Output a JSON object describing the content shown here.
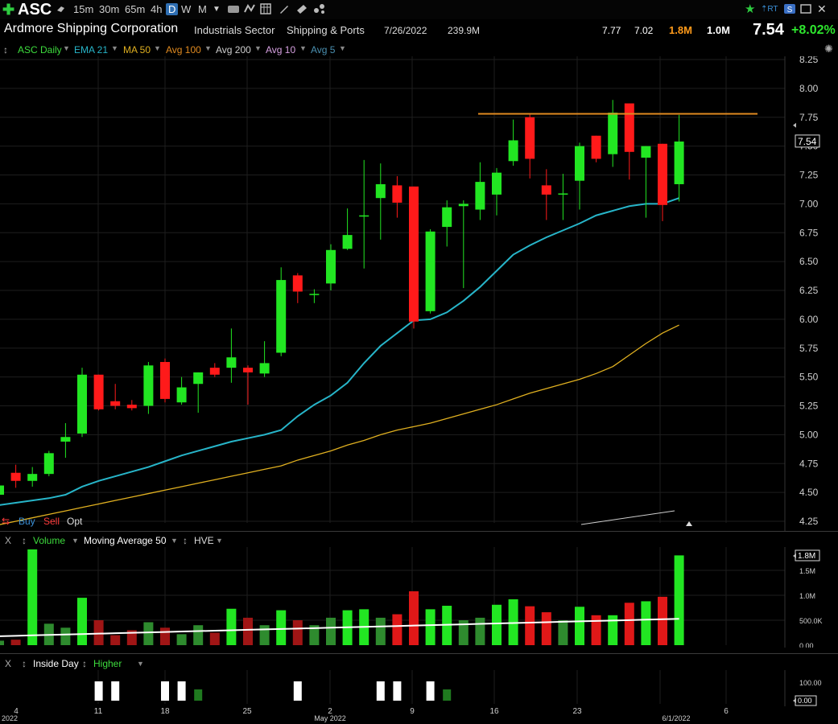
{
  "toolbar": {
    "symbol": "ASC",
    "timeframes": [
      "15m",
      "30m",
      "65m",
      "4h",
      "D",
      "W",
      "M"
    ],
    "selected_timeframe": "D",
    "right_labels": [
      "RT"
    ]
  },
  "info": {
    "company": "Ardmore Shipping Corporation",
    "sector": "Industrials Sector",
    "industry": "Shipping & Ports",
    "earnings_date": "7/26/2022",
    "market_cap": "239.9M",
    "high": "7.77",
    "low": "7.02",
    "volume": "1.8M",
    "avg_volume": "1.0M",
    "last": "7.54",
    "change_pct": "+8.02%"
  },
  "legend": {
    "items": [
      {
        "label": "ASC Daily",
        "color": "#3ddc3d"
      },
      {
        "label": "EMA 21",
        "color": "#27b5c9"
      },
      {
        "label": "MA 50",
        "color": "#e0b020"
      },
      {
        "label": "Avg 100",
        "color": "#e08a20"
      },
      {
        "label": "Avg 200",
        "color": "#cfcfcf"
      },
      {
        "label": "Avg 10",
        "color": "#d6a0e0"
      },
      {
        "label": "Avg 5",
        "color": "#4a8fb0"
      }
    ]
  },
  "trade": {
    "buy": "Buy",
    "sell": "Sell",
    "opt": "Opt"
  },
  "volume_pane": {
    "close_label": "X",
    "title": "Volume",
    "ma_label": "Moving Average 50",
    "hve_label": "HVE",
    "last_value_label": "1.8M",
    "axis_labels": [
      "1.5M",
      "1.0M",
      "500.0K",
      "0.00"
    ]
  },
  "inside_pane": {
    "close_label": "X",
    "title": "Inside Day",
    "higher_label": "Higher",
    "axis_labels": [
      "100.00",
      "0.00"
    ]
  },
  "colors": {
    "up": "#22e622",
    "down": "#ff1a1a",
    "ema21": "#27b5c9",
    "ma50": "#e0b020",
    "resistance": "#e08a20",
    "axis_text": "#cfcfcf"
  },
  "chart_data": {
    "type": "candlestick",
    "y_axis_ticks": [
      4.25,
      4.5,
      4.75,
      5.0,
      5.25,
      5.5,
      5.75,
      6.0,
      6.25,
      6.5,
      6.75,
      7.0,
      7.25,
      7.5,
      7.75,
      8.0,
      8.25
    ],
    "y_axis_labels": [
      "4.25",
      "4.50",
      "4.75",
      "5.00",
      "5.25",
      "5.50",
      "5.75",
      "6.00",
      "6.25",
      "6.50",
      "6.75",
      "7.00",
      "7.25",
      "7.50",
      "7.75",
      "8.00",
      "8.25"
    ],
    "ylim": [
      4.2,
      8.3
    ],
    "x_axis_labels": [
      "2022",
      "4",
      "11",
      "18",
      "25",
      "2",
      "May 2022",
      "9",
      "16",
      "23",
      "6/1/2022",
      "6"
    ],
    "last_price_label": "7.54",
    "resistance_level": 7.78,
    "candles": [
      {
        "o": 4.48,
        "h": 4.56,
        "l": 4.42,
        "c": 4.56,
        "v": 0.09
      },
      {
        "o": 4.67,
        "h": 4.74,
        "l": 4.54,
        "c": 4.6,
        "v": 0.11
      },
      {
        "o": 4.6,
        "h": 4.72,
        "l": 4.55,
        "c": 4.66,
        "v": 1.92
      },
      {
        "o": 4.66,
        "h": 4.86,
        "l": 4.64,
        "c": 4.84,
        "v": 0.43
      },
      {
        "o": 4.94,
        "h": 5.1,
        "l": 4.8,
        "c": 4.98,
        "v": 0.35
      },
      {
        "o": 5.01,
        "h": 5.58,
        "l": 4.98,
        "c": 5.52,
        "v": 0.95
      },
      {
        "o": 5.52,
        "h": 5.52,
        "l": 5.21,
        "c": 5.22,
        "v": 0.5
      },
      {
        "o": 5.29,
        "h": 5.44,
        "l": 5.22,
        "c": 5.25,
        "v": 0.2
      },
      {
        "o": 5.26,
        "h": 5.3,
        "l": 5.21,
        "c": 5.23,
        "v": 0.3
      },
      {
        "o": 5.25,
        "h": 5.63,
        "l": 5.18,
        "c": 5.6,
        "v": 0.46
      },
      {
        "o": 5.63,
        "h": 5.66,
        "l": 5.28,
        "c": 5.31,
        "v": 0.35
      },
      {
        "o": 5.28,
        "h": 5.5,
        "l": 5.26,
        "c": 5.41,
        "v": 0.22
      },
      {
        "o": 5.44,
        "h": 5.54,
        "l": 5.19,
        "c": 5.54,
        "v": 0.4
      },
      {
        "o": 5.58,
        "h": 5.62,
        "l": 5.5,
        "c": 5.52,
        "v": 0.25
      },
      {
        "o": 5.58,
        "h": 5.92,
        "l": 5.45,
        "c": 5.67,
        "v": 0.73
      },
      {
        "o": 5.58,
        "h": 5.6,
        "l": 5.26,
        "c": 5.54,
        "v": 0.55
      },
      {
        "o": 5.53,
        "h": 5.81,
        "l": 5.5,
        "c": 5.62,
        "v": 0.4
      },
      {
        "o": 5.71,
        "h": 6.45,
        "l": 5.68,
        "c": 6.34,
        "v": 0.7
      },
      {
        "o": 6.38,
        "h": 6.4,
        "l": 6.14,
        "c": 6.24,
        "v": 0.5
      },
      {
        "o": 6.22,
        "h": 6.26,
        "l": 6.14,
        "c": 6.22,
        "v": 0.4
      },
      {
        "o": 6.31,
        "h": 6.65,
        "l": 6.25,
        "c": 6.6,
        "v": 0.55
      },
      {
        "o": 6.61,
        "h": 6.96,
        "l": 6.6,
        "c": 6.73,
        "v": 0.7
      },
      {
        "o": 6.9,
        "h": 7.38,
        "l": 6.44,
        "c": 6.9,
        "v": 0.72
      },
      {
        "o": 7.05,
        "h": 7.35,
        "l": 6.69,
        "c": 7.17,
        "v": 0.55
      },
      {
        "o": 7.16,
        "h": 7.24,
        "l": 6.88,
        "c": 7.01,
        "v": 0.62
      },
      {
        "o": 7.15,
        "h": 7.15,
        "l": 5.92,
        "c": 5.98,
        "v": 1.08
      },
      {
        "o": 6.07,
        "h": 6.78,
        "l": 6.05,
        "c": 6.76,
        "v": 0.72
      },
      {
        "o": 6.8,
        "h": 7.03,
        "l": 6.63,
        "c": 6.97,
        "v": 0.79
      },
      {
        "o": 6.98,
        "h": 7.03,
        "l": 6.27,
        "c": 7.0,
        "v": 0.5
      },
      {
        "o": 6.95,
        "h": 7.36,
        "l": 6.86,
        "c": 7.19,
        "v": 0.55
      },
      {
        "o": 7.08,
        "h": 7.31,
        "l": 6.9,
        "c": 7.27,
        "v": 0.81
      },
      {
        "o": 7.37,
        "h": 7.73,
        "l": 7.33,
        "c": 7.55,
        "v": 0.92
      },
      {
        "o": 7.75,
        "h": 7.78,
        "l": 7.22,
        "c": 7.39,
        "v": 0.78
      },
      {
        "o": 7.16,
        "h": 7.3,
        "l": 6.86,
        "c": 7.08,
        "v": 0.66
      },
      {
        "o": 7.09,
        "h": 7.26,
        "l": 6.86,
        "c": 7.09,
        "v": 0.5
      },
      {
        "o": 7.2,
        "h": 7.53,
        "l": 6.95,
        "c": 7.5,
        "v": 0.77
      },
      {
        "o": 7.59,
        "h": 7.59,
        "l": 7.36,
        "c": 7.39,
        "v": 0.6
      },
      {
        "o": 7.43,
        "h": 7.9,
        "l": 7.32,
        "c": 7.79,
        "v": 0.6
      },
      {
        "o": 7.87,
        "h": 7.87,
        "l": 7.21,
        "c": 7.45,
        "v": 0.85
      },
      {
        "o": 7.4,
        "h": 7.5,
        "l": 6.88,
        "c": 7.5,
        "v": 0.88
      },
      {
        "o": 7.52,
        "h": 7.52,
        "l": 6.85,
        "c": 6.99,
        "v": 0.97
      },
      {
        "o": 7.17,
        "h": 7.77,
        "l": 7.02,
        "c": 7.54,
        "v": 1.8
      }
    ],
    "ema21": [
      4.39,
      4.41,
      4.43,
      4.45,
      4.48,
      4.55,
      4.6,
      4.64,
      4.68,
      4.72,
      4.77,
      4.82,
      4.86,
      4.9,
      4.94,
      4.97,
      5.0,
      5.04,
      5.16,
      5.26,
      5.34,
      5.45,
      5.62,
      5.77,
      5.88,
      5.99,
      6.0,
      6.06,
      6.16,
      6.28,
      6.42,
      6.56,
      6.64,
      6.71,
      6.77,
      6.83,
      6.9,
      6.94,
      6.98,
      7.0,
      7.0,
      7.05
    ],
    "ma50": [
      4.22,
      4.25,
      4.28,
      4.31,
      4.34,
      4.37,
      4.4,
      4.43,
      4.46,
      4.49,
      4.52,
      4.55,
      4.58,
      4.61,
      4.64,
      4.67,
      4.7,
      4.73,
      4.78,
      4.82,
      4.86,
      4.91,
      4.95,
      5.0,
      5.04,
      5.07,
      5.1,
      5.14,
      5.18,
      5.22,
      5.26,
      5.31,
      5.36,
      5.4,
      5.44,
      5.48,
      5.53,
      5.59,
      5.69,
      5.79,
      5.88,
      5.95
    ]
  }
}
